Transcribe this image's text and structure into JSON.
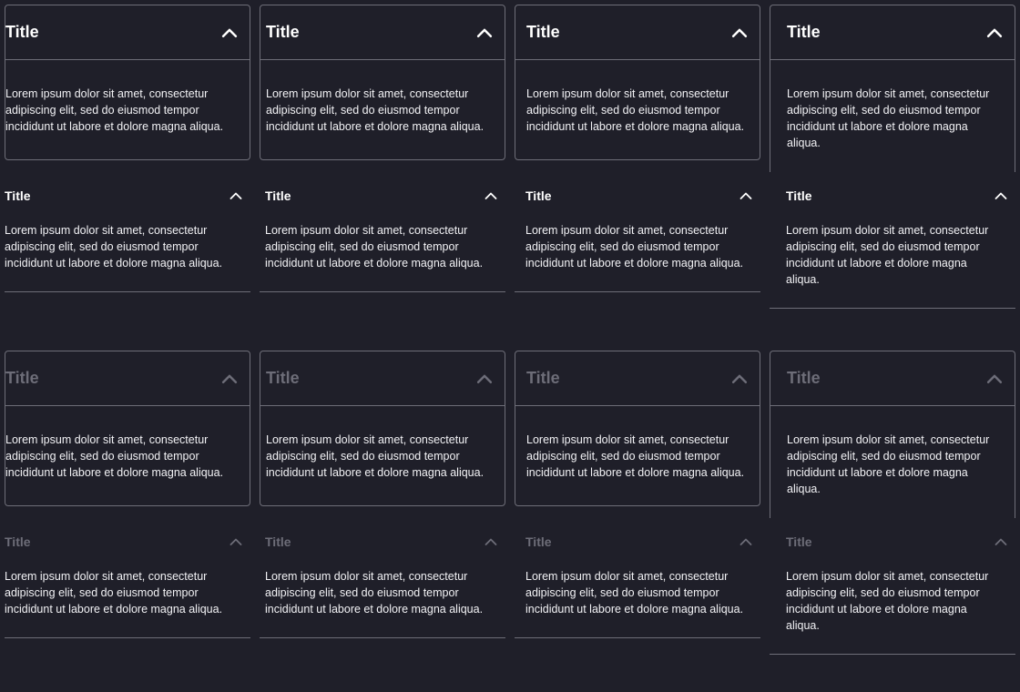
{
  "title_text": "Title",
  "body_text": "Lorem ipsum dolor sit amet, consectetur adipiscing elit, sed do eiusmod tempor incididunt ut labore et dolore magna aliqua.",
  "colors": {
    "background": "#1f1f29",
    "border": "#6e6e78",
    "text": "#ffffff",
    "disabled_text": "#6d6d78"
  },
  "icons": {
    "toggle": "chevron-up-icon"
  },
  "sections": [
    {
      "state": "enabled"
    },
    {
      "state": "disabled"
    }
  ]
}
